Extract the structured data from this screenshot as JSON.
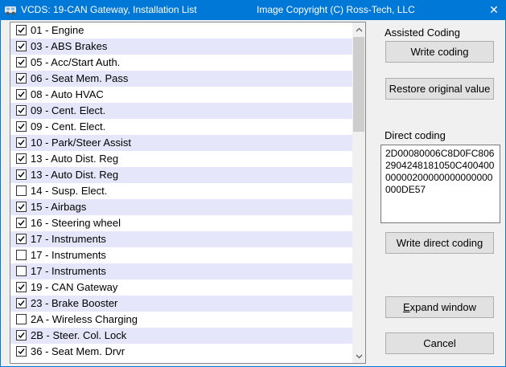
{
  "window": {
    "title_left": "VCDS: 19-CAN Gateway,  Installation List",
    "title_right": "Image Copyright (C) Ross-Tech, LLC",
    "close_glyph": "✕"
  },
  "modules": [
    {
      "label": "01 - Engine",
      "checked": true
    },
    {
      "label": "03 - ABS Brakes",
      "checked": true
    },
    {
      "label": "05 - Acc/Start Auth.",
      "checked": true
    },
    {
      "label": "06 - Seat Mem. Pass",
      "checked": true
    },
    {
      "label": "08 - Auto HVAC",
      "checked": true
    },
    {
      "label": "09 - Cent. Elect.",
      "checked": true
    },
    {
      "label": "09 - Cent. Elect.",
      "checked": true
    },
    {
      "label": "10 - Park/Steer Assist",
      "checked": true
    },
    {
      "label": "13 - Auto Dist. Reg",
      "checked": true
    },
    {
      "label": "13 - Auto Dist. Reg",
      "checked": true
    },
    {
      "label": "14 - Susp. Elect.",
      "checked": false
    },
    {
      "label": "15 - Airbags",
      "checked": true
    },
    {
      "label": "16 - Steering wheel",
      "checked": true
    },
    {
      "label": "17 - Instruments",
      "checked": true
    },
    {
      "label": "17 - Instruments",
      "checked": false
    },
    {
      "label": "17 - Instruments",
      "checked": false
    },
    {
      "label": "19 - CAN Gateway",
      "checked": true
    },
    {
      "label": "23 - Brake Booster",
      "checked": true
    },
    {
      "label": "2A - Wireless Charging",
      "checked": false
    },
    {
      "label": "2B - Steer. Col. Lock",
      "checked": true
    },
    {
      "label": "36 - Seat Mem. Drvr",
      "checked": true
    }
  ],
  "coding": {
    "assisted_label": "Assisted Coding",
    "write_coding": "Write coding",
    "restore_original": "Restore original value",
    "direct_label": "Direct coding",
    "direct_value": "2D00080006C8D0FC8062904248181050C40040000000200000000000000000DE57",
    "write_direct": "Write direct coding"
  },
  "actions": {
    "expand_prefix": "",
    "expand_mnemonic": "E",
    "expand_rest": "xpand window",
    "cancel": "Cancel"
  },
  "colors": {
    "titlebar": "#0078d7",
    "row_alt": "#e6e6fa",
    "button_face": "#e1e1e1"
  }
}
